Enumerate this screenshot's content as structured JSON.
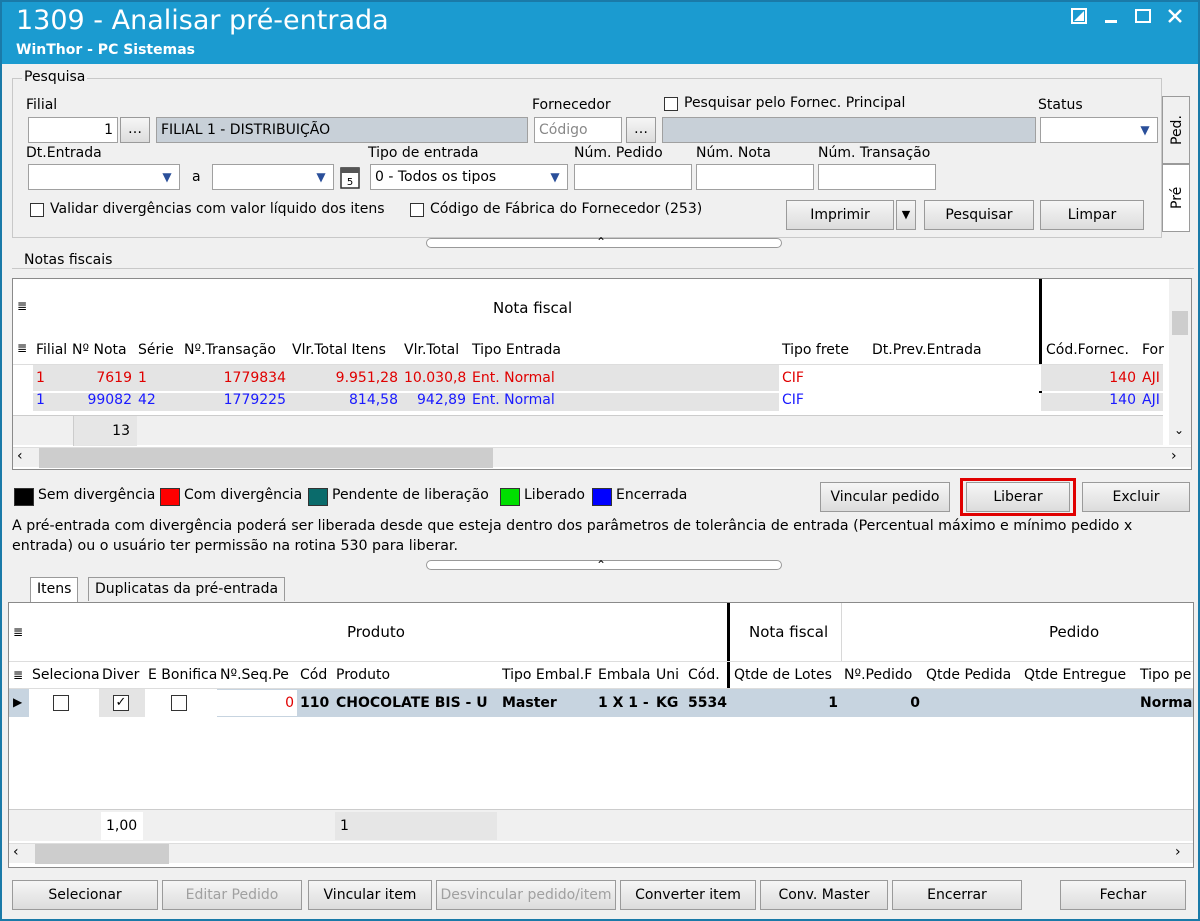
{
  "window": {
    "title": "1309 - Analisar pré-entrada",
    "subtitle": "WinThor - PC Sistemas"
  },
  "pesquisa": {
    "group_label": "Pesquisa",
    "filial_label": "Filial",
    "filial_code": "1",
    "filial_name": "FILIAL 1 - DISTRIBUIÇÃO",
    "fornecedor_label": "Fornecedor",
    "fornecedor_placeholder": "Código",
    "pesquisar_fornec_label": "Pesquisar pelo Fornec. Principal",
    "status_label": "Status",
    "dt_entrada_label": "Dt.Entrada",
    "a_label": "a",
    "tipo_entrada_label": "Tipo de entrada",
    "tipo_entrada_value": "0 - Todos os tipos",
    "num_pedido_label": "Núm. Pedido",
    "num_nota_label": "Núm. Nota",
    "num_transacao_label": "Núm. Transação",
    "validar_label": "Validar divergências com valor líquido dos itens",
    "codigo_fabrica_label": "Código de Fábrica do Fornecedor (253)",
    "imprimir_label": "Imprimir",
    "pesquisar_label": "Pesquisar",
    "limpar_label": "Limpar",
    "side_tabs": [
      "Ped.",
      "Pré"
    ]
  },
  "notas": {
    "group_label": "Notas fiscais",
    "band_header": "Nota fiscal",
    "columns": [
      "Filial",
      "Nº Nota",
      "Série",
      "Nº.Transação",
      "Vlr.Total Itens",
      "Vlr.Total",
      "Tipo Entrada",
      "Tipo frete",
      "Dt.Prev.Entrada",
      "Cód.Fornec.",
      "For"
    ],
    "rows": [
      {
        "filial": "1",
        "nota": "7619",
        "serie": "1",
        "transacao": "1779834",
        "vlr_itens": "9.951,28",
        "vlr_total": "10.030,8",
        "tipo_entrada": "Ent. Normal",
        "tipo_frete": "CIF",
        "dt_prev": "",
        "cod_fornec": "140",
        "for": "AJI",
        "color": "#e00000"
      },
      {
        "filial": "1",
        "nota": "99082",
        "serie": "42",
        "transacao": "1779225",
        "vlr_itens": "814,58",
        "vlr_total": "942,89",
        "tipo_entrada": "Ent. Normal",
        "tipo_frete": "CIF",
        "dt_prev": "",
        "cod_fornec": "140",
        "for": "AJI",
        "color": "#1a1aff"
      }
    ],
    "footer_count": "13"
  },
  "legend": [
    {
      "label": "Sem divergência",
      "color": "#000000"
    },
    {
      "label": "Com divergência",
      "color": "#ff0000"
    },
    {
      "label": "Pendente de liberação",
      "color": "#0a6b6b"
    },
    {
      "label": "Liberado",
      "color": "#00e000"
    },
    {
      "label": "Encerrada",
      "color": "#0000ff"
    }
  ],
  "actions": {
    "vincular_pedido": "Vincular pedido",
    "liberar": "Liberar",
    "excluir": "Excluir",
    "highlight_color": "#e00000"
  },
  "info_text_line1": "A pré-entrada com divergência poderá ser liberada desde que esteja dentro dos parâmetros de tolerância de entrada (Percentual máximo e mínimo pedido x",
  "info_text_line2": "entrada) ou o usuário ter permissão na rotina 530 para liberar.",
  "tabs": [
    "Itens",
    "Duplicatas da pré-entrada"
  ],
  "itens": {
    "band_produto": "Produto",
    "band_nota": "Nota fiscal",
    "band_pedido": "Pedido",
    "columns": [
      "Seleciona",
      "Diver",
      "E Bonifica",
      "Nº.Seq.Pe",
      "Cód",
      "Produto",
      "Tipo Embal.F",
      "Embala",
      "Uni",
      "Cód.",
      "Qtde de Lotes",
      "Nº.Pedido",
      "Qtde Pedida",
      "Qtde Entregue",
      "Tipo pe"
    ],
    "row": {
      "selecionar": false,
      "diver": true,
      "bonifica": false,
      "seq": "0",
      "cod": "110",
      "produto": "CHOCOLATE BIS - U",
      "tipo_embal": "Master",
      "embala": "1 X 1 -",
      "uni": "KG",
      "cod2": "5534",
      "lotes": "1",
      "pedido": "0",
      "qtde_pedida": "",
      "qtde_entregue": "",
      "tipo_pe": "Norma"
    },
    "footer_a": "1,00",
    "footer_b": "1"
  },
  "bottom_buttons": [
    {
      "label": "Selecionar",
      "enabled": true
    },
    {
      "label": "Editar Pedido",
      "enabled": false
    },
    {
      "label": "Vincular item",
      "enabled": true
    },
    {
      "label": "Desvincular pedido/item",
      "enabled": false
    },
    {
      "label": "Converter item",
      "enabled": true
    },
    {
      "label": "Conv. Master",
      "enabled": true
    },
    {
      "label": "Encerrar",
      "enabled": true
    },
    {
      "label": "Fechar",
      "enabled": true
    }
  ]
}
